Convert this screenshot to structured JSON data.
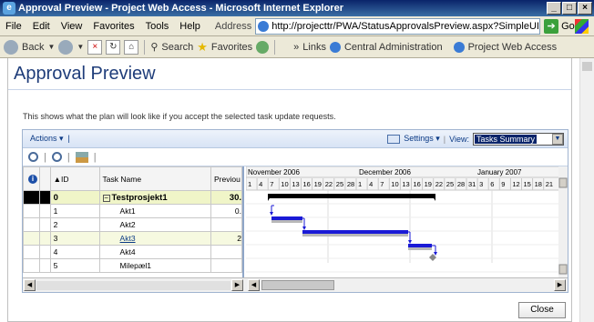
{
  "window": {
    "title": "Approval Preview - Project Web Access - Microsoft Internet Explorer"
  },
  "menu": [
    "File",
    "Edit",
    "View",
    "Favorites",
    "Tools",
    "Help"
  ],
  "address": {
    "label": "Address",
    "url": "http://projecttr/PWA/StatusApprovalsPreview.aspx?SimpleUI=-15&_a",
    "go": "Go"
  },
  "toolbar": {
    "back": "Back",
    "search": "Search",
    "favorites": "Favorites",
    "links_label": "Links",
    "link1": "Central Administration",
    "link2": "Project Web Access"
  },
  "page": {
    "title": "Approval Preview",
    "description": "This shows what the plan will look like if you accept the selected task update requests.",
    "close_label": "Close"
  },
  "grid_toolbar": {
    "actions": "Actions",
    "settings": "Settings",
    "view_label": "View:",
    "view_value": "Tasks Summary"
  },
  "columns": {
    "id": "ID",
    "name": "Task Name",
    "prev": "Previou"
  },
  "rows": [
    {
      "id": "0",
      "name": "Testprosjekt1",
      "prev": "30."
    },
    {
      "id": "1",
      "name": "Akt1",
      "prev": "0."
    },
    {
      "id": "2",
      "name": "Akt2",
      "prev": ""
    },
    {
      "id": "3",
      "name": "Akt3",
      "prev": "2"
    },
    {
      "id": "4",
      "name": "Akt4",
      "prev": ""
    },
    {
      "id": "5",
      "name": "Milepæl1",
      "prev": ""
    }
  ],
  "gantt": {
    "months": [
      "November 2006",
      "December 2006",
      "January 2007"
    ],
    "days": [
      "1",
      "4",
      "7",
      "10",
      "13",
      "16",
      "19",
      "22",
      "25",
      "28",
      "1",
      "4",
      "7",
      "10",
      "13",
      "16",
      "19",
      "22",
      "25",
      "28",
      "31",
      "3",
      "6",
      "9",
      "12",
      "15",
      "18",
      "21"
    ]
  },
  "colors": {
    "accent": "#1f3d7a",
    "summary_row": "#f0f5c8",
    "bar_blue": "#1a1ad6",
    "bar_grey": "#b8b8b8"
  }
}
